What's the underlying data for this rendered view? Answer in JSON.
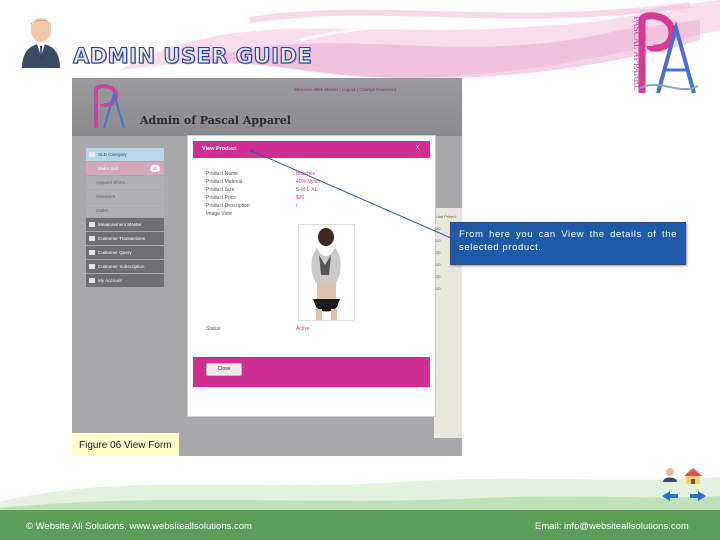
{
  "header": {
    "title": "ADMIN USER GUIDE",
    "logo_text": "PASCAL APPAREL"
  },
  "screenshot": {
    "app_title": "Admin of Pascal Apparel",
    "top_nav": "Welcome Web Master | Logout | Change Password",
    "sidebar": {
      "items": [
        {
          "label": "SLD Category"
        },
        {
          "label": "Swim Suit",
          "badge": "32"
        },
        {
          "label": "Apparel Shirts"
        },
        {
          "label": "Sweaters"
        },
        {
          "label": "Outlet"
        },
        {
          "label": "Measurement Master"
        },
        {
          "label": "Customer Transactions"
        },
        {
          "label": "Customer Query"
        },
        {
          "label": "Customer Subscription"
        },
        {
          "label": "My Account"
        }
      ]
    },
    "table": {
      "header": "Unit Priced",
      "cells": [
        "20",
        "20",
        "20",
        "20",
        "20",
        "20"
      ]
    },
    "modal": {
      "title": "View Product",
      "close_x": "x",
      "fields": [
        {
          "label": "Product Name",
          "value": "Blotches"
        },
        {
          "label": "Product Material",
          "value": "40% Nylon"
        },
        {
          "label": "Product Size",
          "value": "S-M-L-XL"
        },
        {
          "label": "Product Price",
          "value": "$20"
        },
        {
          "label": "Product Description",
          "value": "r"
        },
        {
          "label": "Image View",
          "value": ""
        }
      ],
      "status_label": "Status",
      "status_value": "Active",
      "close_button": "Close"
    }
  },
  "caption": "Figure 06 View Form",
  "callout": "From here you can View the details of the selected product.",
  "footer": {
    "left": "© Website All Solutions. www.websiteallsolutions.com",
    "right": "Email: info@websiteallsolutions.com"
  },
  "colors": {
    "accent_pink": "#cf2f92",
    "callout_blue": "#1f5aa8",
    "footer_green": "#5b9e58",
    "title_blue": "#2a3fa0"
  }
}
